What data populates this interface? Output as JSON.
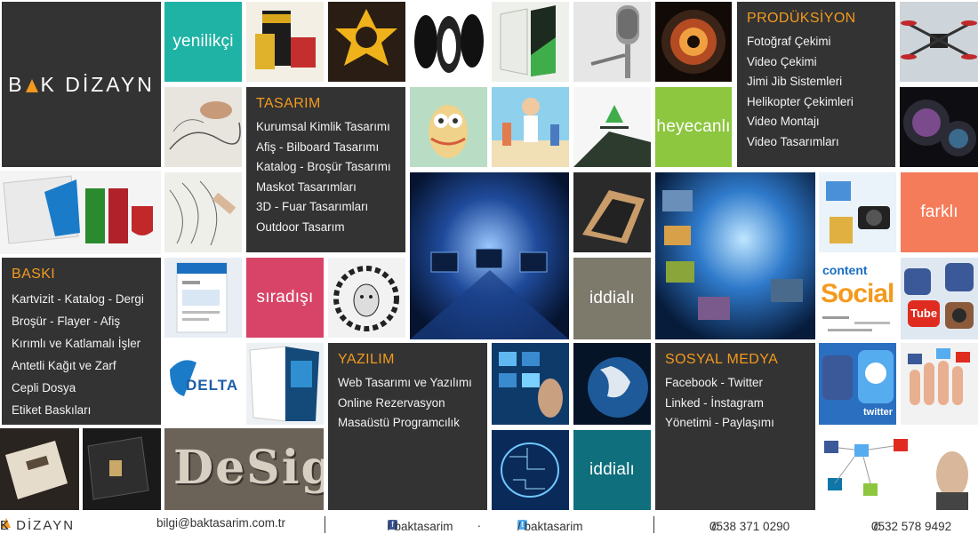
{
  "brand": {
    "name_start": "B",
    "name_end": "K DİZAYN"
  },
  "words": {
    "yenilikci": "yenilikçi",
    "heyecanli": "heyecanlı",
    "farkli": "farklı",
    "siradisi": "sıradışı",
    "iddiali_1": "iddialı",
    "iddiali_2": "iddialı"
  },
  "colors": {
    "accent": "#f39a1e",
    "teal": "#1fb3a5",
    "green": "#8dc63f",
    "salmon": "#f47c5a",
    "crimson": "#d84467",
    "olive": "#7d7a6c",
    "petrol": "#0f6f7d",
    "panel": "#333333"
  },
  "panels": {
    "produksiyon": {
      "title": "PRODÜKSİYON",
      "items": [
        "Fotoğraf Çekimi",
        "Video Çekimi",
        "Jimi Jib Sistemleri",
        "Helikopter Çekimleri",
        "Video Montajı",
        "Video Tasarımları"
      ]
    },
    "tasarim": {
      "title": "TASARIM",
      "items": [
        "Kurumsal Kimlik Tasarımı",
        "Afiş - Bilboard Tasarımı",
        "Katalog - Broşür Tasarımı",
        "Maskot Tasarımları",
        "3D - Fuar Tasarımları",
        "Outdoor Tasarım"
      ]
    },
    "baski": {
      "title": "BASKI",
      "items": [
        "Kartvizit - Katalog - Dergi",
        "Broşür - Flayer - Afiş",
        "Kırımlı ve Katlamalı İşler",
        "Antetli Kağıt ve Zarf",
        "Cepli Dosya",
        "Etiket Baskıları"
      ]
    },
    "yazilim": {
      "title": "YAZILIM",
      "items": [
        "Web Tasarımı ve Yazılımı",
        "Online Rezervasyon",
        "Masaüstü Programcılık"
      ]
    },
    "sosyal": {
      "title": "SOSYAL MEDYA",
      "items": [
        "Facebook - Twitter",
        "Linked - İnstagram",
        "Yönetimi - Paylaşımı"
      ]
    }
  },
  "image_text": {
    "design": "DeSign",
    "social": "Social",
    "content": "content",
    "delta": "DELTA",
    "tube": "Tube",
    "twitter": "twitter"
  },
  "footer": {
    "logo_start": "B",
    "logo_end": "K DİZAYN",
    "email": "bilgi@baktasarim.com.tr",
    "facebook": "/ baktasarim",
    "dot": ".",
    "twitter": "/ baktasarim",
    "phone1": "0538 371 0290",
    "phone2": "0532 578 9492",
    "phone_icon": "phone-icon"
  }
}
